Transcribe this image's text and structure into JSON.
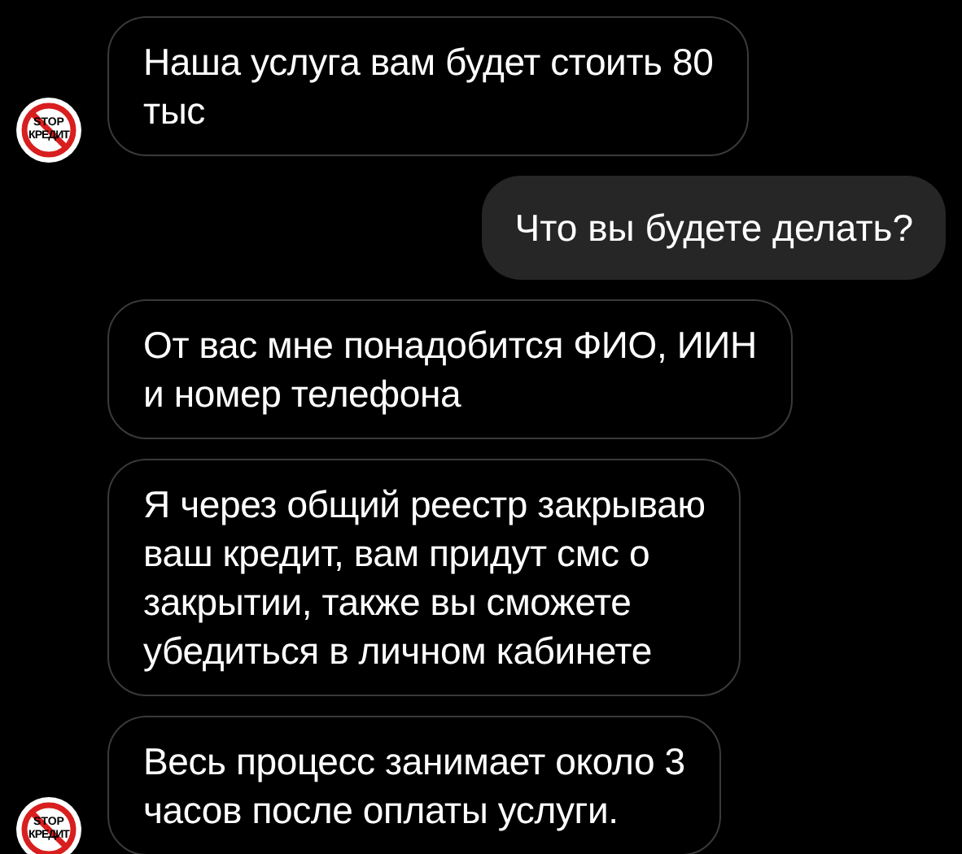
{
  "messages": [
    {
      "kind": "incoming",
      "text": "Наша услуга вам будет стоить 80\nтыс",
      "avatar": {
        "lines": [
          "STOP",
          "КРЕДИТ"
        ]
      }
    },
    {
      "kind": "outgoing",
      "text": "Что вы будете делать?"
    },
    {
      "kind": "incoming",
      "text": "От вас мне понадобится ФИО, ИИН\nи номер телефона"
    },
    {
      "kind": "incoming",
      "text": "Я через общий реестр закрываю\nваш кредит, вам придут смс о\nзакрытии, также вы сможете\nубедиться в личном кабинете"
    },
    {
      "kind": "incoming",
      "text": "Весь процесс занимает около 3\nчасов после оплаты услуги.",
      "avatar": {
        "lines": [
          "STOP",
          "КРЕДИТ"
        ]
      }
    }
  ]
}
